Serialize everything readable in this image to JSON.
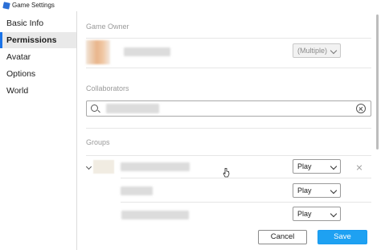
{
  "window": {
    "title": "Game Settings"
  },
  "sidebar": {
    "items": [
      {
        "label": "Basic Info",
        "selected": false
      },
      {
        "label": "Permissions",
        "selected": true
      },
      {
        "label": "Avatar",
        "selected": false
      },
      {
        "label": "Options",
        "selected": false
      },
      {
        "label": "World",
        "selected": false
      }
    ]
  },
  "permissions": {
    "game_owner": {
      "section_label": "Game Owner",
      "permission": "(Multiple)"
    },
    "collaborators": {
      "section_label": "Collaborators",
      "search_value": ""
    },
    "groups": {
      "section_label": "Groups",
      "rows": [
        {
          "permission": "Play"
        },
        {
          "permission": "Play"
        },
        {
          "permission": "Play"
        }
      ]
    }
  },
  "footer": {
    "cancel_label": "Cancel",
    "save_label": "Save"
  },
  "colors": {
    "accent": "#1a73e8",
    "save_button": "#1ea1f2",
    "selected_nav_bg": "#e9e9e9"
  },
  "icons": [
    "roblox-studio-icon",
    "search-icon",
    "clear-icon",
    "chevron-down-icon",
    "expand-chevron-icon",
    "remove-icon",
    "mouse-cursor-icon"
  ]
}
